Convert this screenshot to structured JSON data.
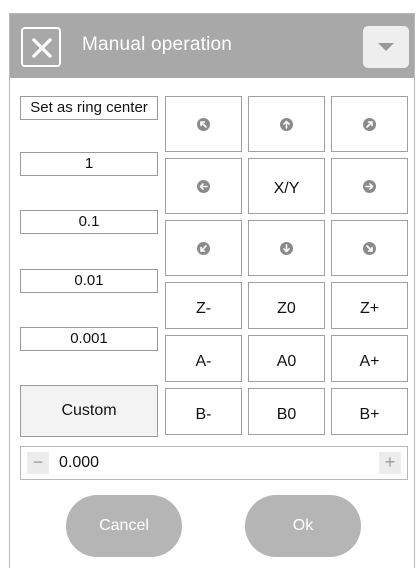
{
  "window": {
    "title": "Manual operation"
  },
  "presets": {
    "ring_center": "Set as ring center",
    "steps": [
      "1",
      "0.1",
      "0.01",
      "0.001"
    ],
    "custom": "Custom"
  },
  "pad": {
    "xy_label": "X/Y",
    "z_minus": "Z-",
    "z_zero": "Z0",
    "z_plus": "Z+",
    "a_minus": "A-",
    "a_zero": "A0",
    "a_plus": "A+",
    "b_minus": "B-",
    "b_zero": "B0",
    "b_plus": "B+"
  },
  "stepper": {
    "minus": "−",
    "value": "0.000",
    "plus": "+"
  },
  "footer": {
    "cancel": "Cancel",
    "ok": "Ok"
  },
  "colors": {
    "titlebar": "#a8a8a8",
    "pill": "#b5b5b5",
    "arrow_dot": "#8a8a8a"
  },
  "icons": {
    "close": "close-icon",
    "menu": "chevron-down-icon",
    "arrows": [
      "arrow-up-left-icon",
      "arrow-up-icon",
      "arrow-up-right-icon",
      "arrow-left-icon",
      "arrow-right-icon",
      "arrow-down-left-icon",
      "arrow-down-icon",
      "arrow-down-right-icon"
    ]
  }
}
